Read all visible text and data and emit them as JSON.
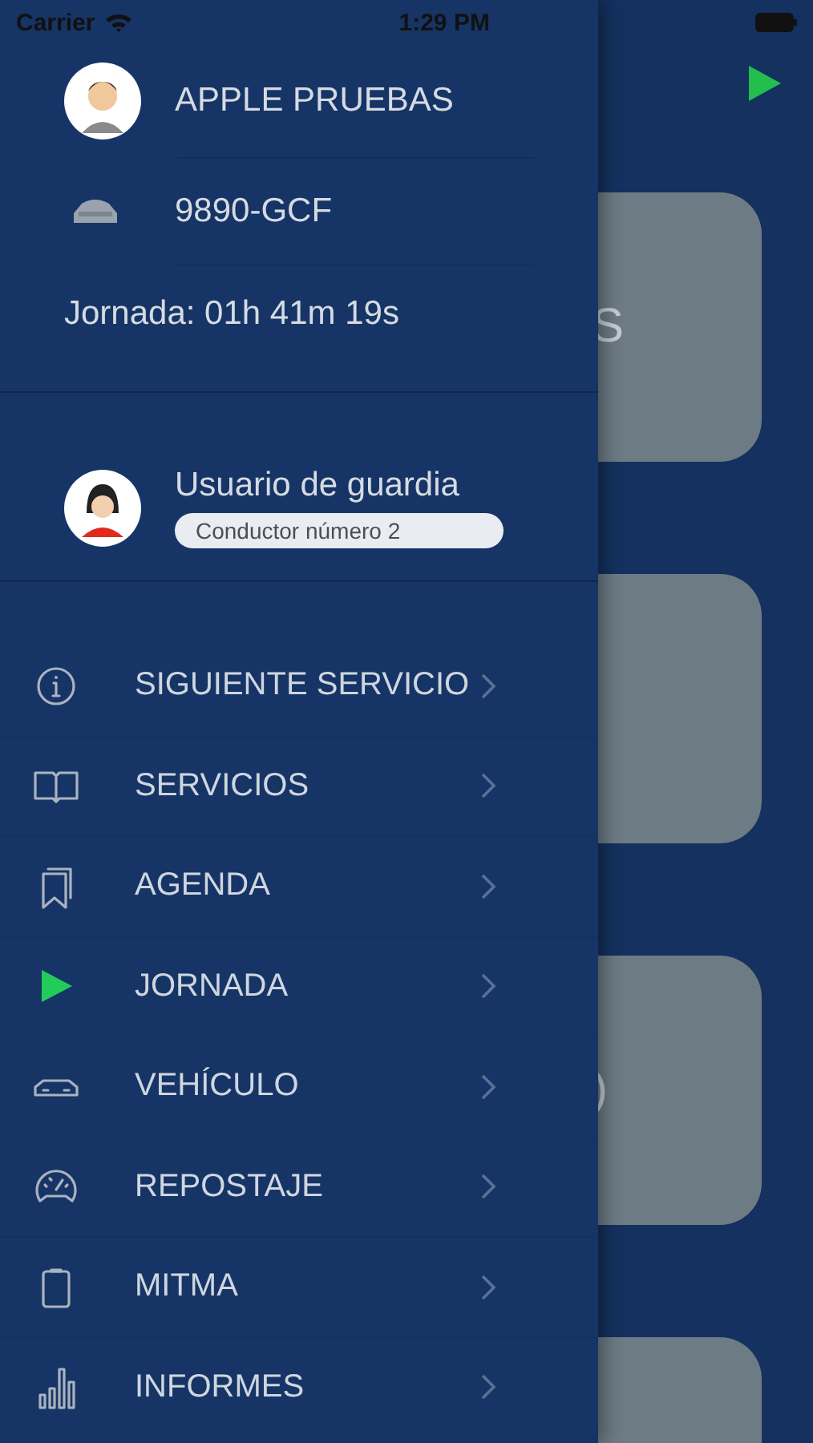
{
  "status_bar": {
    "carrier": "Carrier",
    "time": "1:29 PM"
  },
  "drawer": {
    "user": {
      "name": "APPLE PRUEBAS"
    },
    "vehicle": {
      "plate": "9890-GCF"
    },
    "shift": "Jornada: 01h 41m 19s",
    "on_call": {
      "name": "Usuario de guardia",
      "badge": "Conductor número 2"
    },
    "menu": [
      {
        "label": "SIGUIENTE SERVICIO"
      },
      {
        "label": "SERVICIOS"
      },
      {
        "label": "AGENDA"
      },
      {
        "label": "JORNADA"
      },
      {
        "label": "VEHÍCULO"
      },
      {
        "label": "REPOSTAJE"
      },
      {
        "label": "MITMA"
      },
      {
        "label": "INFORMES"
      }
    ]
  },
  "background": {
    "cards": [
      {
        "kind": "card",
        "text": "S"
      },
      {
        "kind": "card"
      },
      {
        "kind": "card",
        "text": ")"
      },
      {
        "kind": "card"
      }
    ]
  }
}
